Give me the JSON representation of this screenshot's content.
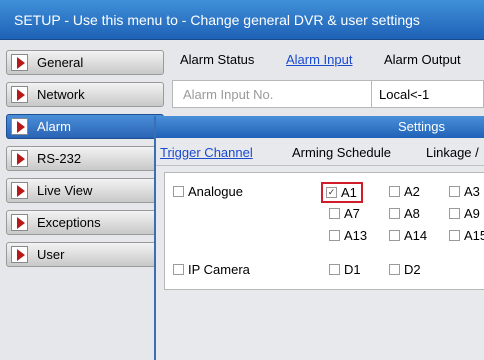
{
  "title": "SETUP - Use this menu to - Change general DVR & user settings",
  "sidebar": {
    "items": [
      {
        "label": "General",
        "active": false
      },
      {
        "label": "Network",
        "active": false
      },
      {
        "label": "Alarm",
        "active": true
      },
      {
        "label": "RS-232",
        "active": false
      },
      {
        "label": "Live View",
        "active": false
      },
      {
        "label": "Exceptions",
        "active": false
      },
      {
        "label": "User",
        "active": false
      }
    ]
  },
  "alarm_panel": {
    "tabs": [
      "Alarm Status",
      "Alarm Input",
      "Alarm Output"
    ],
    "active_tab": "Alarm Input",
    "input_no_placeholder": "Alarm Input No.",
    "input_no_value": "Local<-1"
  },
  "settings_dialog": {
    "title": "Settings",
    "tabs": [
      "Trigger Channel",
      "Arming Schedule",
      "Linkage /"
    ],
    "active_tab": "Trigger Channel",
    "analogue": {
      "label": "Analogue",
      "channels": [
        {
          "label": "A1",
          "checked": true
        },
        {
          "label": "A2",
          "checked": false
        },
        {
          "label": "A3",
          "checked": false
        },
        {
          "label": "A7",
          "checked": false
        },
        {
          "label": "A8",
          "checked": false
        },
        {
          "label": "A9",
          "checked": false
        },
        {
          "label": "A13",
          "checked": false
        },
        {
          "label": "A14",
          "checked": false
        },
        {
          "label": "A15",
          "checked": false
        }
      ]
    },
    "ip_camera": {
      "label": "IP Camera",
      "channels": [
        {
          "label": "D1",
          "checked": false
        },
        {
          "label": "D2",
          "checked": false
        }
      ]
    }
  }
}
